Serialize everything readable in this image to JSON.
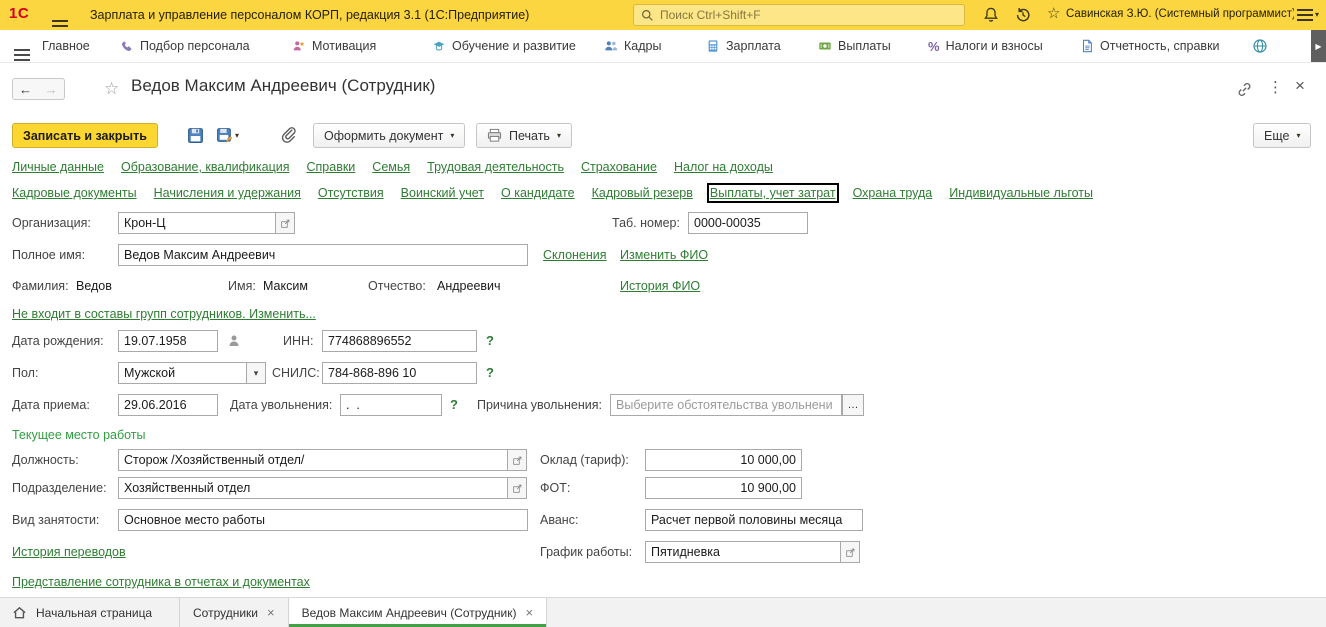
{
  "colors": {
    "titlebar_bg": "#fcd640",
    "primary_button_bg": "#fcd631",
    "link_green": "#2e7d32",
    "section_header_green": "#2f9e41",
    "active_tab_underline": "#44a047"
  },
  "titlebar": {
    "logo": "1С",
    "app_title": "Зарплата и управление персоналом КОРП, редакция 3.1 (1С:Предприятие)",
    "search_placeholder": "Поиск Ctrl+Shift+F",
    "user": "Савинская З.Ю. (Системный программист)"
  },
  "menubar": {
    "items": [
      "Главное",
      "Подбор персонала",
      "Мотивация",
      "Обучение и развитие",
      "Кадры",
      "Зарплата",
      "Выплаты",
      "Налоги и взносы",
      "Отчетность, справки"
    ]
  },
  "form": {
    "title": "Ведов Максим Андреевич (Сотрудник)",
    "toolbar": {
      "save_close": "Записать и закрыть",
      "create_document": "Оформить документ",
      "print": "Печать",
      "more": "Еще"
    },
    "nav_row1": [
      "Личные данные",
      "Образование, квалификация",
      "Справки",
      "Семья",
      "Трудовая деятельность",
      "Страхование",
      "Налог на доходы"
    ],
    "nav_row2": [
      "Кадровые документы",
      "Начисления и удержания",
      "Отсутствия",
      "Воинский учет",
      "О кандидате",
      "Кадровый резерв",
      "Выплаты, учет затрат",
      "Охрана труда",
      "Индивидуальные льготы"
    ],
    "fields": {
      "org_label": "Организация:",
      "org_value": "Крон-Ц",
      "tab_num_label": "Таб. номер:",
      "tab_num_value": "0000-00035",
      "full_name_label": "Полное имя:",
      "full_name_value": "Ведов Максим Андреевич",
      "declension_link": "Склонения",
      "change_fio_link": "Изменить ФИО",
      "surname_label": "Фамилия:",
      "surname_value": "Ведов",
      "firstname_label": "Имя:",
      "firstname_value": "Максим",
      "patronymic_label": "Отчество:",
      "patronymic_value": "Андреевич",
      "fio_history_link": "История ФИО",
      "groups_link": "Не входит в составы групп сотрудников. Изменить...",
      "birthdate_label": "Дата рождения:",
      "birthdate_value": "19.07.1958",
      "inn_label": "ИНН:",
      "inn_value": "774868896552",
      "gender_label": "Пол:",
      "gender_value": "Мужской",
      "snils_label": "СНИЛС:",
      "snils_value": "784-868-896 10",
      "hire_date_label": "Дата приема:",
      "hire_date_value": "29.06.2016",
      "dismiss_date_label": "Дата увольнения:",
      "dismiss_date_value": ".  .",
      "dismiss_reason_label": "Причина увольнения:",
      "dismiss_reason_placeholder": "Выберите обстоятельства увольнени",
      "current_workplace_header": "Текущее место работы",
      "position_label": "Должность:",
      "position_value": "Сторож /Хозяйственный отдел/",
      "salary_label": "Оклад (тариф):",
      "salary_value": "10 000,00",
      "department_label": "Подразделение:",
      "department_value": "Хозяйственный отдел",
      "fot_label": "ФОТ:",
      "fot_value": "10 900,00",
      "employment_label": "Вид занятости:",
      "employment_value": "Основное место работы",
      "advance_label": "Аванс:",
      "advance_value": "Расчет первой половины месяца",
      "transfer_history_link": "История переводов",
      "schedule_label": "График работы:",
      "schedule_value": "Пятидневка",
      "representation_link": "Представление сотрудника в отчетах и документах"
    }
  },
  "taskbar": {
    "home_label": "Начальная страница",
    "tabs": [
      {
        "label": "Сотрудники"
      },
      {
        "label": "Ведов Максим Андреевич (Сотрудник)"
      }
    ]
  }
}
